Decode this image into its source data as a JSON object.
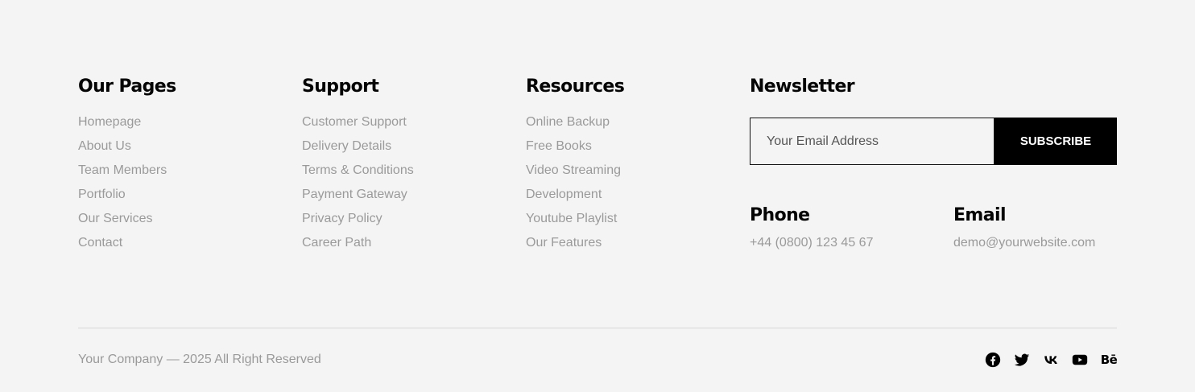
{
  "columns": {
    "pages": {
      "title": "Our Pages",
      "links": [
        "Homepage",
        "About Us",
        "Team Members",
        "Portfolio",
        "Our Services",
        "Contact"
      ]
    },
    "support": {
      "title": "Support",
      "links": [
        "Customer Support",
        "Delivery Details",
        "Terms & Conditions",
        "Payment Gateway",
        "Privacy Policy",
        "Career Path"
      ]
    },
    "resources": {
      "title": "Resources",
      "links": [
        "Online Backup",
        "Free Books",
        "Video Streaming",
        "Development",
        "Youtube Playlist",
        "Our Features"
      ]
    }
  },
  "newsletter": {
    "title": "Newsletter",
    "email_placeholder": "Your Email Address",
    "email_value": "",
    "subscribe_label": "SUBSCRIBE"
  },
  "contact": {
    "phone_title": "Phone",
    "phone_value": "+44 (0800) 123 45 67",
    "email_title": "Email",
    "email_value": "demo@yourwebsite.com"
  },
  "bottom": {
    "copyright": "Your Company — 2025 All Right Reserved",
    "socials": [
      "facebook-icon",
      "twitter-icon",
      "vk-icon",
      "youtube-icon",
      "behance-icon"
    ],
    "behance_glyph": "Bē"
  },
  "colors": {
    "background": "#f4f4f4",
    "heading": "#050505",
    "link": "#9a9a9a",
    "button_bg": "#000000",
    "button_text": "#ffffff",
    "divider": "#d6d6d6"
  }
}
